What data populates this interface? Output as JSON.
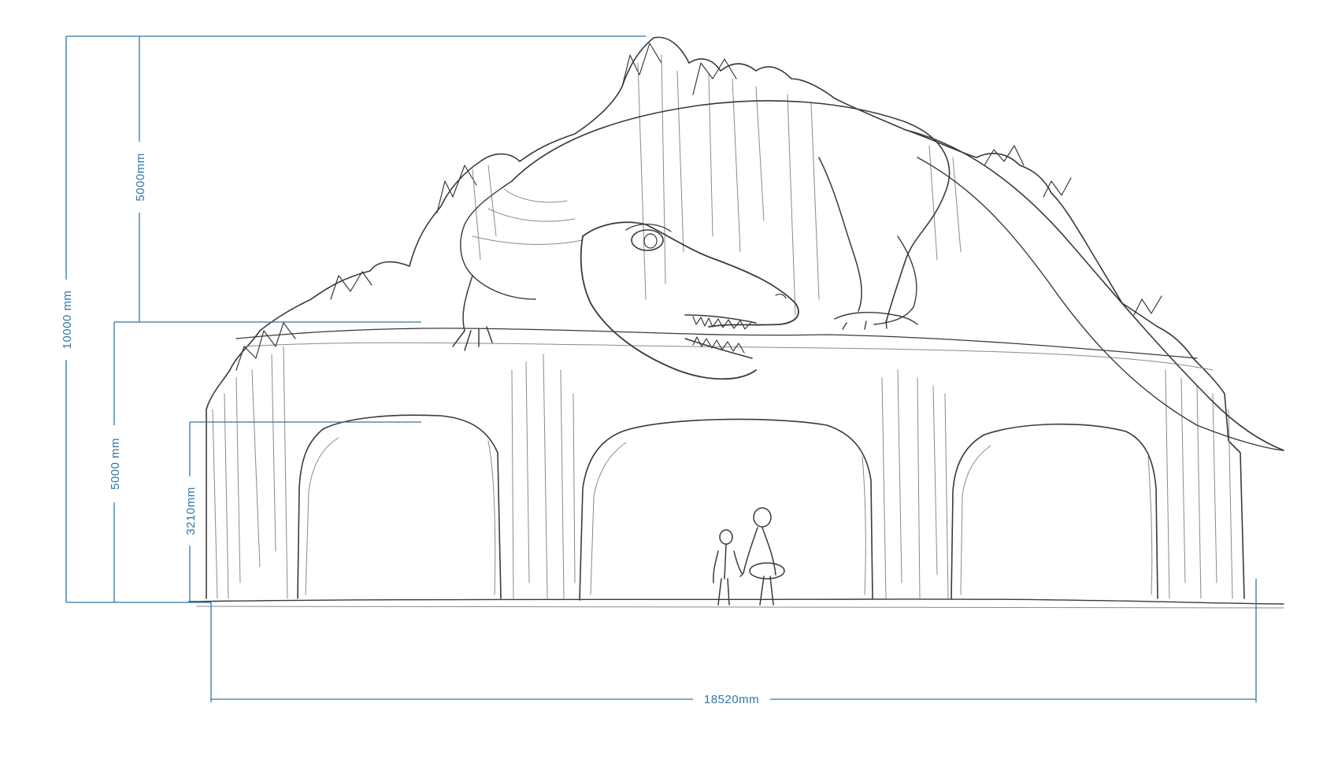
{
  "dimensions": {
    "total_height": "10000 mm",
    "upper_height": "5000mm",
    "lower_height": "5000 mm",
    "arch_height": "3210mm",
    "total_width": "18520mm"
  },
  "colors": {
    "dimension": "#2f76a8",
    "sketch": "#3a3a3a",
    "background": "#ffffff"
  },
  "figures": [
    "dinosaur",
    "rock-arch-gate",
    "people-scale"
  ]
}
